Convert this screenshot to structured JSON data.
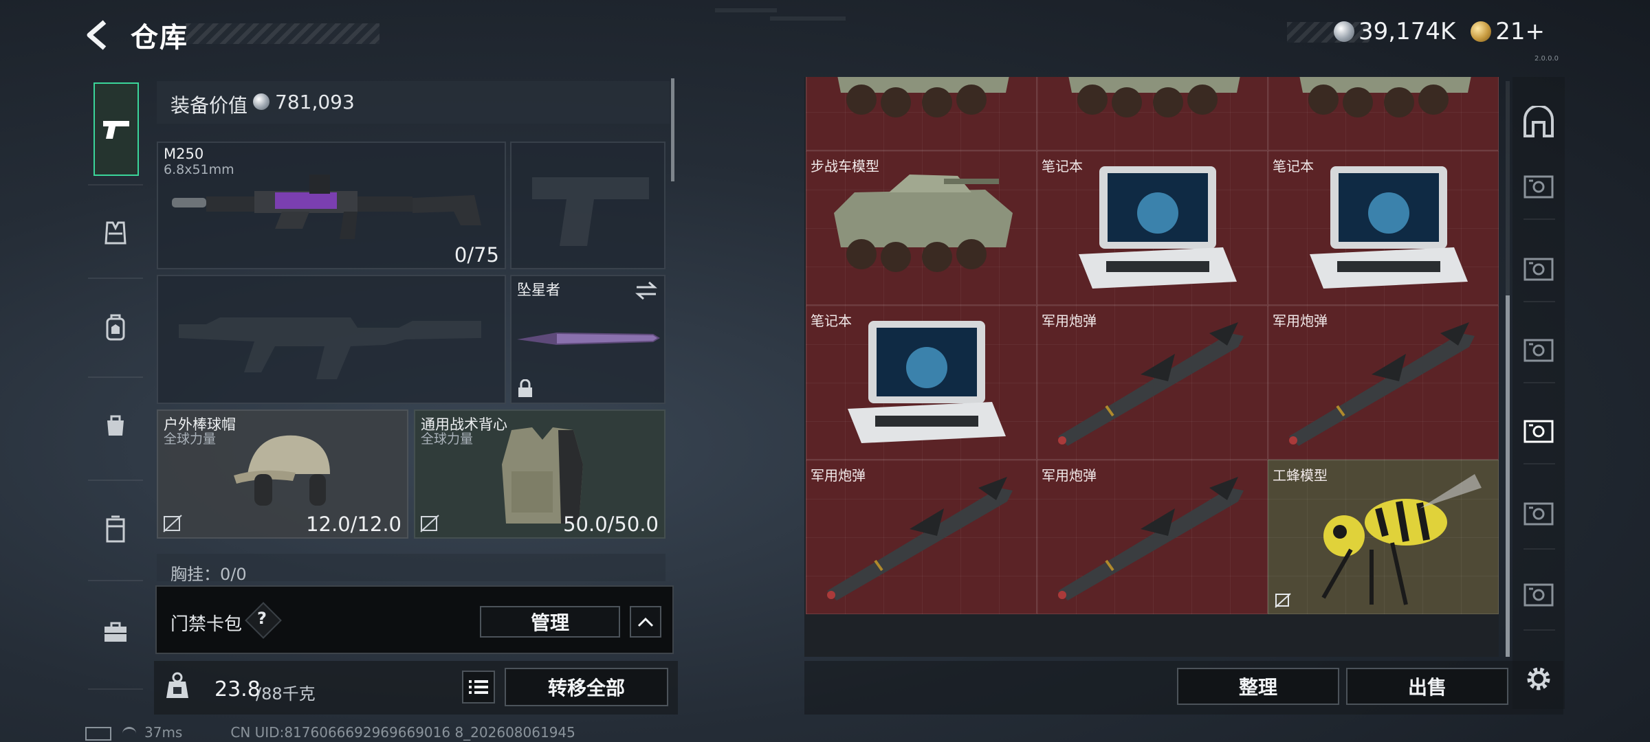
{
  "header": {
    "title": "仓库"
  },
  "currency": {
    "silver": "39,174K",
    "gold": "21+"
  },
  "build": "2.0.0.0",
  "loadout": {
    "equip_value_label": "装备价值",
    "equip_value": "781,093",
    "primary": {
      "name": "M250",
      "ammo": "6.8x51mm",
      "durability": "0/75"
    },
    "melee": {
      "name": "坠星者"
    },
    "helmet": {
      "name": "户外棒球帽",
      "sub": "全球力量",
      "durability": "12.0/12.0"
    },
    "armor": {
      "name": "通用战术背心",
      "sub": "全球力量",
      "durability": "50.0/50.0"
    },
    "chest_rig": {
      "label": "胸挂：0/0"
    },
    "keycard": {
      "label": "门禁卡包",
      "help": "?",
      "manage": "管理"
    },
    "weight": {
      "current": "23.8",
      "max": "/88千克"
    },
    "transfer_all": "转移全部"
  },
  "grid": {
    "cells": [
      {
        "label": ""
      },
      {
        "label": ""
      },
      {
        "label": ""
      },
      {
        "label": "步战车模型"
      },
      {
        "label": "笔记本"
      },
      {
        "label": "笔记本"
      },
      {
        "label": "笔记本"
      },
      {
        "label": "军用炮弹"
      },
      {
        "label": "军用炮弹"
      },
      {
        "label": "军用炮弹"
      },
      {
        "label": "军用炮弹"
      },
      {
        "label": "工蜂模型"
      }
    ],
    "sort_label": "整理",
    "sell_label": "出售"
  },
  "status": {
    "ping": "37ms",
    "uid": "CN UID:8176066692969669016 8_202608061945"
  },
  "colors": {
    "accent": "#3bd69a",
    "cell_red": "#5b2326",
    "cell_gold": "#4f4a36"
  }
}
